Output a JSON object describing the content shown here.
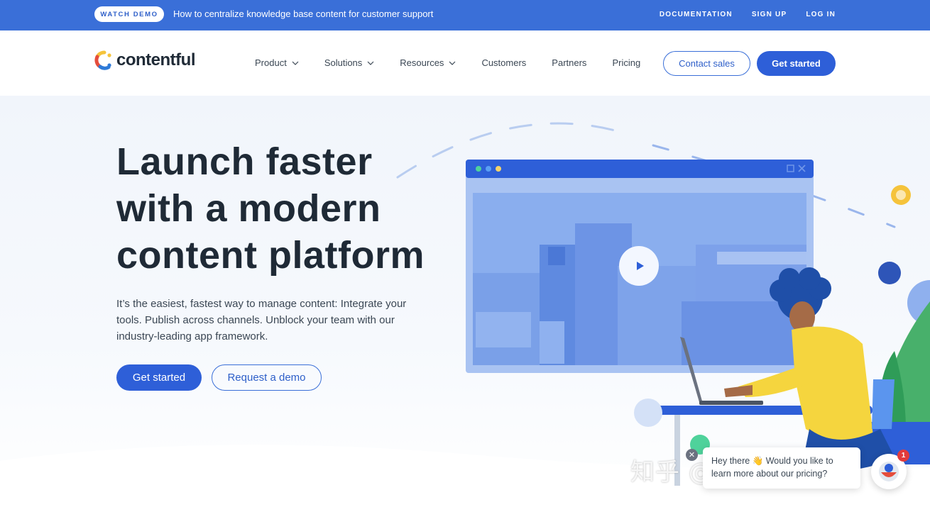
{
  "topbar": {
    "watch_demo": "WATCH DEMO",
    "announcement": "How to centralize knowledge base content for customer support",
    "links": [
      "DOCUMENTATION",
      "SIGN UP",
      "LOG IN"
    ]
  },
  "nav": {
    "logo_text": "contentful",
    "menu": [
      {
        "label": "Product",
        "dropdown": true
      },
      {
        "label": "Solutions",
        "dropdown": true
      },
      {
        "label": "Resources",
        "dropdown": true
      },
      {
        "label": "Customers",
        "dropdown": false
      },
      {
        "label": "Partners",
        "dropdown": false
      },
      {
        "label": "Pricing",
        "dropdown": false
      }
    ],
    "contact_sales": "Contact sales",
    "get_started": "Get started"
  },
  "hero": {
    "title_lines": [
      "Launch faster",
      "with a modern",
      "content platform"
    ],
    "description": "It’s the easiest, fastest way to manage content: Integrate your tools. Publish across channels. Unblock your team with our industry-leading app framework.",
    "primary_cta": "Get started",
    "secondary_cta": "Request a demo"
  },
  "chat": {
    "message": "Hey there 👋 Would you like to learn more about our pricing?",
    "unread_count": "1",
    "close_symbol": "✕"
  },
  "watermark": "知乎 @李明Martian",
  "colors": {
    "brand_blue": "#2e5fd8",
    "topbar_blue": "#3a6fd8",
    "text_dark": "#1f2a36"
  }
}
